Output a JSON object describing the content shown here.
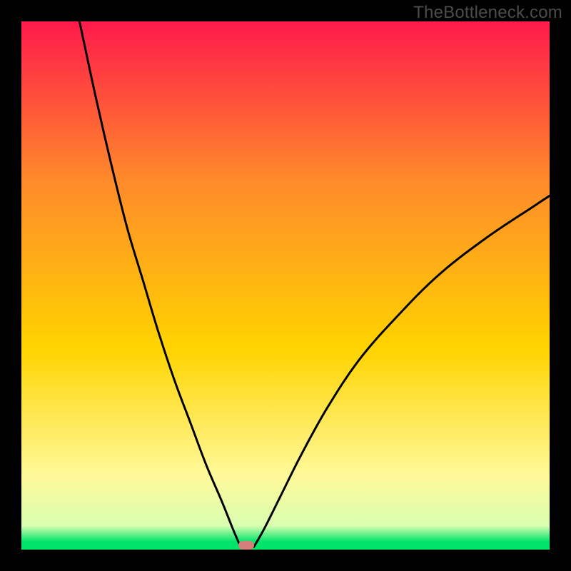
{
  "watermark": "TheBottleneck.com",
  "chart_data": {
    "type": "line",
    "title": "",
    "xlabel": "",
    "ylabel": "",
    "xlim": [
      0,
      100
    ],
    "ylim": [
      0,
      100
    ],
    "gradient_colors": {
      "top": "#ff1a4b",
      "upper_mid": "#ff8a2a",
      "mid": "#ffd400",
      "lower_mid": "#fff99a",
      "band": "#d9ffb0",
      "bottom": "#00e46a"
    },
    "curve_left": {
      "x": [
        11,
        14,
        17,
        20,
        23,
        26,
        29,
        32,
        35,
        38,
        40,
        41.5
      ],
      "y": [
        100,
        86,
        73,
        61,
        51,
        41,
        32,
        24,
        16,
        9,
        4,
        0.5
      ]
    },
    "curve_right": {
      "x": [
        44,
        46,
        49,
        53,
        58,
        64,
        71,
        79,
        88,
        97,
        100
      ],
      "y": [
        0.5,
        4,
        10,
        18,
        27,
        36,
        44,
        52,
        59,
        65,
        67
      ]
    },
    "marker": {
      "x": 42.6,
      "y": 0.8,
      "color": "#d67f7a"
    }
  }
}
